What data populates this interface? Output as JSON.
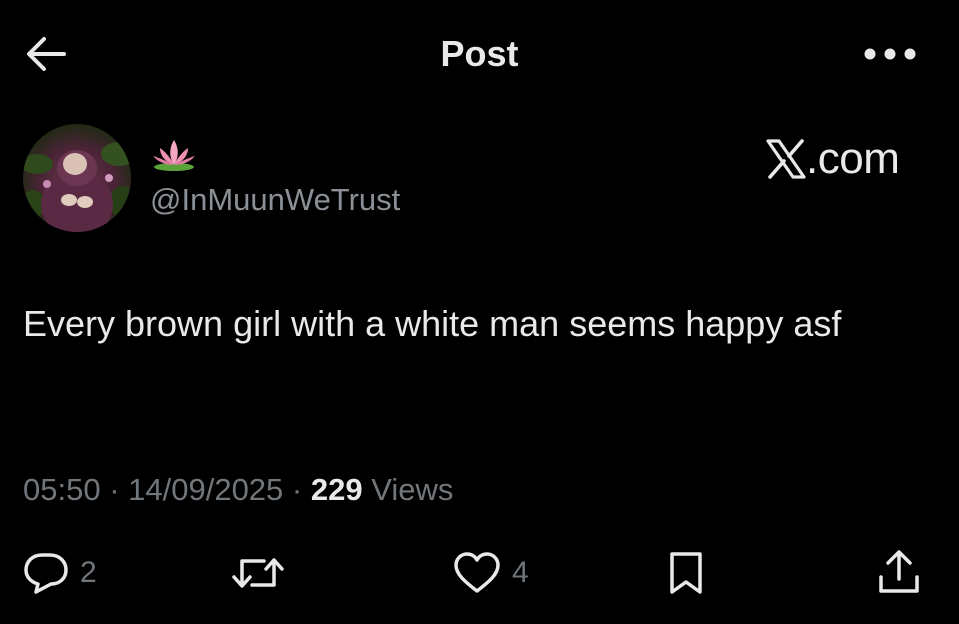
{
  "header": {
    "title": "Post",
    "back_icon": "arrow-left-icon",
    "more_icon": "more-horizontal-icon"
  },
  "author": {
    "display_name_emoji": "🪷",
    "handle": "@InMuunWeTrust"
  },
  "watermark": {
    "logo": "X",
    "text": ".com"
  },
  "post": {
    "text": "Every brown girl with a white man seems happy asf",
    "time": "05:50",
    "date": "14/09/2025",
    "views_count": "229",
    "views_label": "Views"
  },
  "actions": {
    "reply_count": "2",
    "repost_count": "",
    "like_count": "4",
    "bookmark_count": "",
    "share_count": ""
  },
  "colors": {
    "background": "#000000",
    "primary_text": "#e7e9ea",
    "secondary_text": "#71767b"
  }
}
